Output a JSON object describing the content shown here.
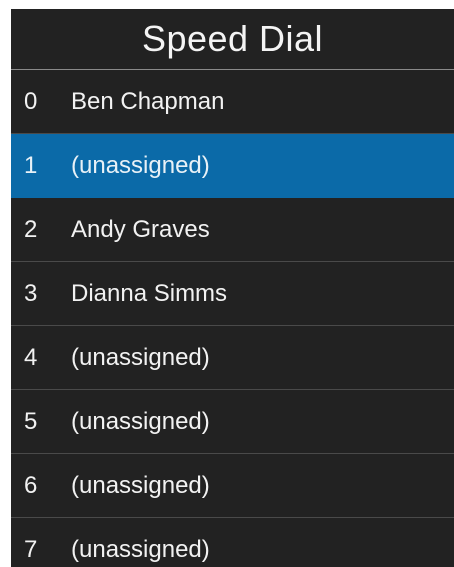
{
  "header": {
    "title": "Speed Dial"
  },
  "theme": {
    "background": "#222222",
    "selected": "#0b6aa8",
    "text": "#f2f2f2"
  },
  "entries": [
    {
      "slot": "0",
      "name": "Ben Chapman",
      "selected": false
    },
    {
      "slot": "1",
      "name": "(unassigned)",
      "selected": true
    },
    {
      "slot": "2",
      "name": "Andy Graves",
      "selected": false
    },
    {
      "slot": "3",
      "name": "Dianna Simms",
      "selected": false
    },
    {
      "slot": "4",
      "name": "(unassigned)",
      "selected": false
    },
    {
      "slot": "5",
      "name": "(unassigned)",
      "selected": false
    },
    {
      "slot": "6",
      "name": "(unassigned)",
      "selected": false
    },
    {
      "slot": "7",
      "name": "(unassigned)",
      "selected": false
    }
  ]
}
